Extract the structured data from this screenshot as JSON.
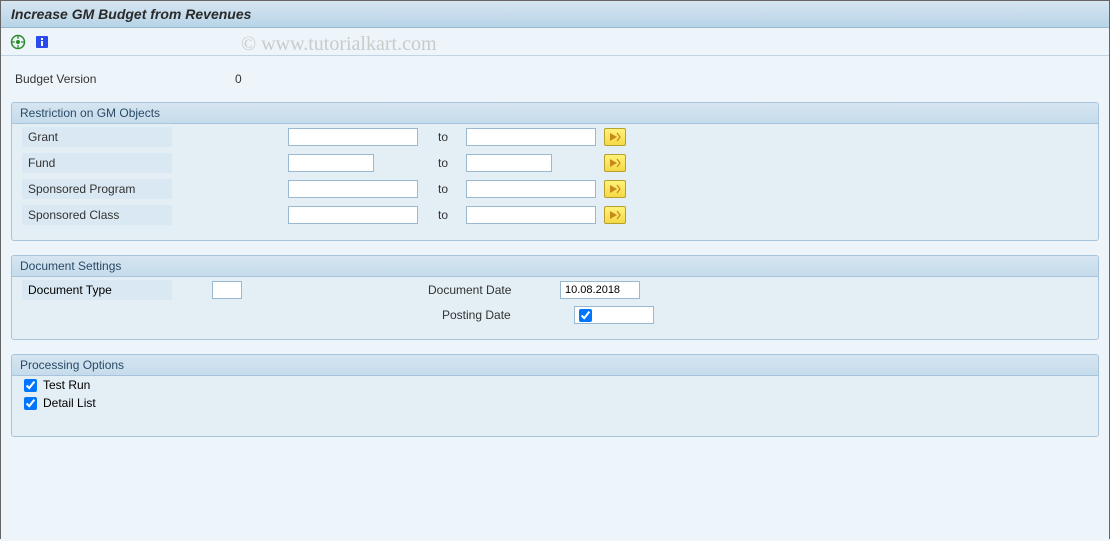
{
  "title": "Increase GM Budget from Revenues",
  "watermark": "© www.tutorialkart.com",
  "budget_version": {
    "label": "Budget Version",
    "value": "0"
  },
  "groups": {
    "restriction": {
      "title": "Restriction on GM Objects",
      "rows": {
        "grant": {
          "label": "Grant",
          "from": "",
          "to_label": "to",
          "to": ""
        },
        "fund": {
          "label": "Fund",
          "from": "",
          "to_label": "to",
          "to": ""
        },
        "sprog": {
          "label": "Sponsored Program",
          "from": "",
          "to_label": "to",
          "to": ""
        },
        "sclass": {
          "label": "Sponsored Class",
          "from": "",
          "to_label": "to",
          "to": ""
        }
      }
    },
    "docset": {
      "title": "Document Settings",
      "document_type": {
        "label": "Document Type",
        "value": ""
      },
      "document_date": {
        "label": "Document Date",
        "value": "10.08.2018"
      },
      "posting_date": {
        "label": "Posting Date",
        "value": "",
        "checked": true
      }
    },
    "procopt": {
      "title": "Processing Options",
      "test_run": {
        "label": "Test Run",
        "checked": true
      },
      "detail_list": {
        "label": "Detail List",
        "checked": true
      }
    }
  }
}
